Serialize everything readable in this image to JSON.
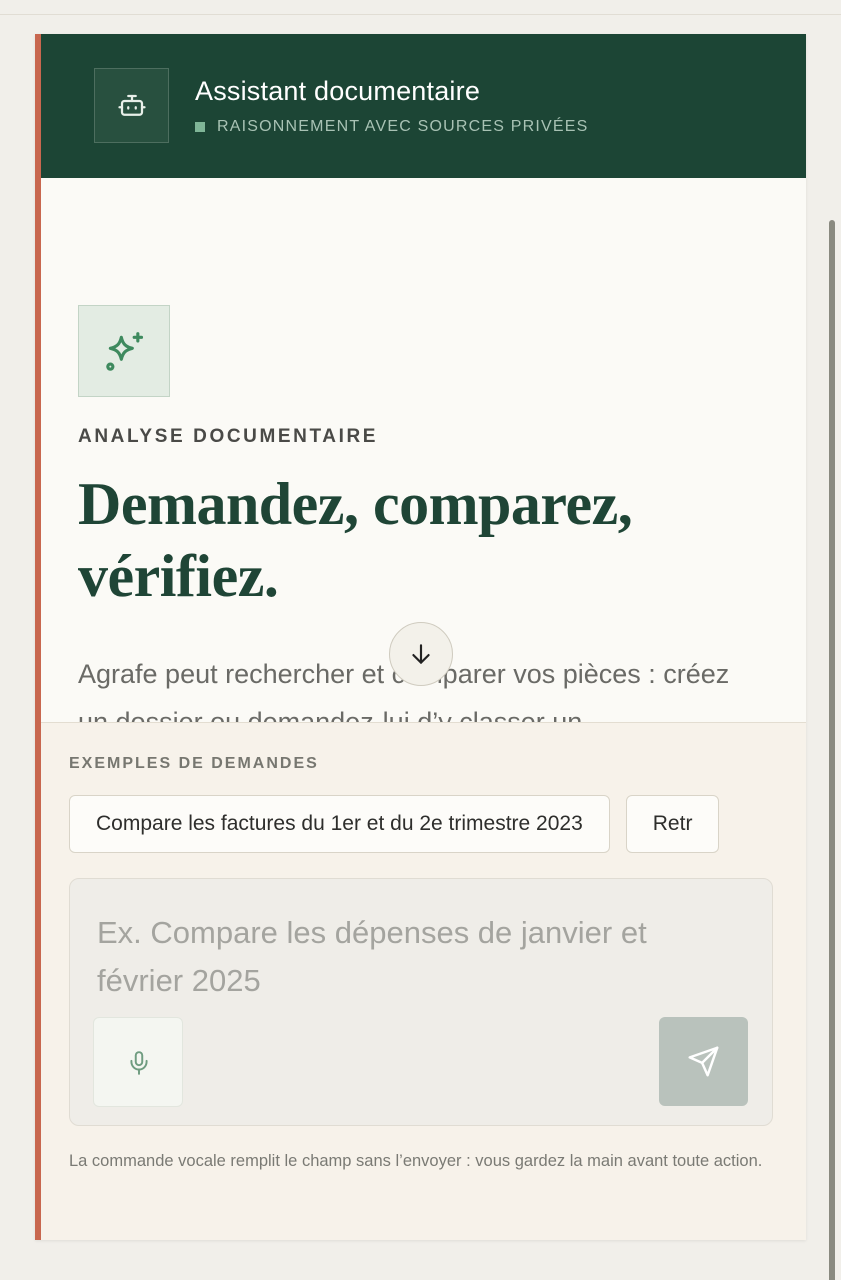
{
  "header": {
    "title": "Assistant documentaire",
    "subtitle": "RAISONNEMENT AVEC SOURCES PRIVÉES",
    "icon": "robot-icon"
  },
  "hero": {
    "icon": "sparkles-icon",
    "kicker": "ANALYSE DOCUMENTAIRE",
    "headline": "Demandez, comparez, vérifiez.",
    "intro": "Agrafe peut rechercher et comparer vos pièces : créez un dossier ou demandez-lui d’y classer un"
  },
  "examples": {
    "label": "EXEMPLES DE DEMANDES",
    "items": [
      "Compare les factures du 1er et du 2e trimestre 2023",
      "Retr"
    ]
  },
  "composer": {
    "placeholder": "Ex. Compare les dépenses de janvier et février 2025",
    "mic_icon": "microphone-icon",
    "send_icon": "send-icon",
    "footnote": "La commande vocale remplit le champ sans l’envoyer : vous gardez la main avant toute action."
  },
  "colors": {
    "header_bg": "#1c4535",
    "accent_border": "#c8674f",
    "headline": "#1f4536"
  }
}
